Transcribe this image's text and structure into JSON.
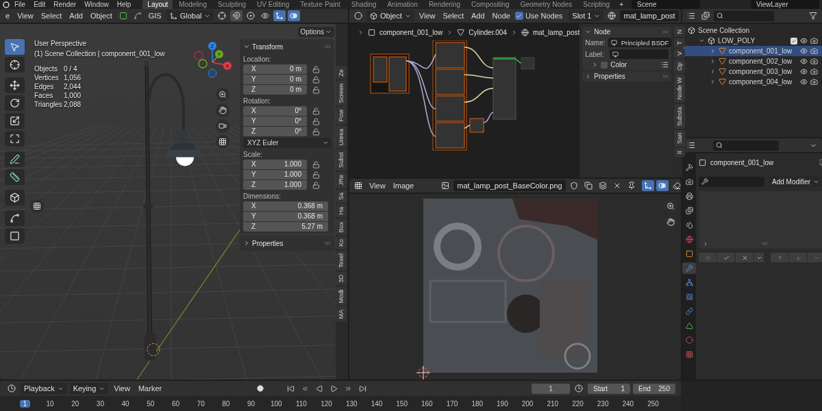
{
  "topbar": {
    "menus": [
      "File",
      "Edit",
      "Render",
      "Window",
      "Help"
    ],
    "workspaces": [
      {
        "label": "Layout",
        "selected": true
      },
      {
        "label": "Modeling",
        "selected": false
      },
      {
        "label": "Sculpting",
        "selected": false
      },
      {
        "label": "UV Editing",
        "selected": false
      },
      {
        "label": "Texture Paint",
        "selected": false
      },
      {
        "label": "Shading",
        "selected": false
      },
      {
        "label": "Animation",
        "selected": false
      },
      {
        "label": "Rendering",
        "selected": false
      },
      {
        "label": "Compositing",
        "selected": false
      },
      {
        "label": "Geometry Nodes",
        "selected": false
      },
      {
        "label": "Scripting",
        "selected": false
      }
    ],
    "add_tab": "+",
    "scene": "Scene",
    "view_layer": "ViewLayer"
  },
  "viewport": {
    "header": {
      "mode": "e",
      "menus": [
        "View",
        "Select",
        "Add",
        "Object"
      ],
      "gis": "GIS",
      "orientation": "Global",
      "toggles": [
        {
          "kind": "snap",
          "on": true
        },
        {
          "kind": "proportional",
          "on": false
        },
        {
          "kind": "gizmo",
          "on": true
        },
        {
          "kind": "overlay",
          "on": true
        }
      ]
    },
    "options": "Options",
    "tools": [
      {
        "kind": "select",
        "selected": true
      },
      {
        "kind": "cursor",
        "selected": false
      },
      {
        "kind": "move",
        "selected": false
      },
      {
        "kind": "rotate",
        "selected": false
      },
      {
        "kind": "scale",
        "selected": false
      },
      {
        "kind": "transform",
        "selected": false
      },
      {
        "kind": "annotate",
        "selected": false
      },
      {
        "kind": "measure",
        "selected": false
      },
      {
        "kind": "add_cube",
        "selected": false
      },
      {
        "kind": "corner",
        "selected": false
      },
      {
        "kind": "diagonal",
        "selected": false
      }
    ],
    "info": {
      "perspective": "User Perspective",
      "collection": "(1) Scene Collection | component_001_low",
      "stats": [
        {
          "label": "Objects",
          "value": "0 / 4"
        },
        {
          "label": "Vertices",
          "value": "1,056"
        },
        {
          "label": "Edges",
          "value": "2,044"
        },
        {
          "label": "Faces",
          "value": "1,000"
        },
        {
          "label": "Triangles",
          "value": "2,088"
        }
      ]
    },
    "axes": [
      {
        "label": "Z",
        "color": "#2f83e0"
      },
      {
        "label": "Y",
        "color": "#6ba621"
      },
      {
        "label": "X",
        "color": "#e43a4b"
      }
    ],
    "transform": {
      "title": "Transform",
      "groups": [
        {
          "label": "Location:",
          "kind": "lockable",
          "rows": [
            {
              "axis": "X",
              "value": "0 m"
            },
            {
              "axis": "Y",
              "value": "0 m"
            },
            {
              "axis": "Z",
              "value": "0 m"
            }
          ]
        },
        {
          "label": "Rotation:",
          "kind": "lockable",
          "mode": "XYZ Euler",
          "rows": [
            {
              "axis": "X",
              "value": "0°"
            },
            {
              "axis": "Y",
              "value": "0°"
            },
            {
              "axis": "Z",
              "value": "0°"
            }
          ]
        },
        {
          "label": "Scale:",
          "kind": "lockable",
          "rows": [
            {
              "axis": "X",
              "value": "1.000"
            },
            {
              "axis": "Y",
              "value": "1.000"
            },
            {
              "axis": "Z",
              "value": "1.000"
            }
          ]
        },
        {
          "label": "Dimensions:",
          "kind": "wide",
          "rows": [
            {
              "axis": "X",
              "value": "0.368 m"
            },
            {
              "axis": "Y",
              "value": "0.368 m"
            },
            {
              "axis": "Z",
              "value": "5.27 m"
            }
          ]
        }
      ],
      "properties": "Properties"
    },
    "tabs": [
      "Ze",
      "Screen",
      "Pow",
      "Unrea",
      "Subst",
      "JRe",
      "Sa",
      "Ha",
      "Box",
      "Ko",
      "Texel",
      "3D",
      "Modi",
      "MA"
    ]
  },
  "node_editor": {
    "mode": "Object",
    "menus": [
      "View",
      "Select",
      "Add",
      "Node"
    ],
    "use_nodes": {
      "label": "Use Nodes",
      "checked": true
    },
    "slot": "Slot 1",
    "material": "mat_lamp_post",
    "breadcrumbs": [
      "component_001_low",
      "Cylinder.004",
      "mat_lamp_post"
    ],
    "node_panel": {
      "title": "Node",
      "name_label": "Name:",
      "name": "Principled BSDF",
      "label_label": "Label:",
      "color_option": {
        "label": "Color",
        "checked": false
      },
      "properties": "Properties"
    },
    "tabs": [
      "N",
      "T",
      "V",
      "Op",
      "Node W",
      "Substa",
      "San",
      "It"
    ]
  },
  "image_editor": {
    "menus": [
      "View",
      "Image"
    ],
    "image": "mat_lamp_post_BaseColor.png",
    "toggles": [
      {
        "kind": "gizmo",
        "on": true
      },
      {
        "kind": "overlay",
        "on": true
      }
    ]
  },
  "outliner": {
    "items": [
      {
        "name": "Scene Collection",
        "selected": false,
        "children": [
          {
            "name": "LOW_POLY",
            "selected": false,
            "expanded": true,
            "checked": true,
            "children": [
              {
                "name": "component_001_low",
                "selected": true,
                "expanded": false
              },
              {
                "name": "component_002_low",
                "selected": false,
                "expanded": false
              },
              {
                "name": "component_003_low",
                "selected": false,
                "expanded": false
              },
              {
                "name": "component_004_low",
                "selected": false,
                "expanded": false
              }
            ]
          }
        ]
      }
    ]
  },
  "properties": {
    "object": "component_001_low",
    "add_modifier": "Add Modifier",
    "tabs": [
      {
        "kind": "tool",
        "selected": false
      },
      {
        "kind": "render",
        "selected": false
      },
      {
        "kind": "output",
        "selected": false
      },
      {
        "kind": "view_layer",
        "selected": false
      },
      {
        "kind": "scene",
        "selected": false
      },
      {
        "kind": "world",
        "selected": false
      },
      {
        "kind": "object",
        "selected": false
      },
      {
        "kind": "modifiers",
        "selected": true
      },
      {
        "kind": "particles",
        "selected": false
      },
      {
        "kind": "physics",
        "selected": false
      },
      {
        "kind": "constraints",
        "selected": false
      },
      {
        "kind": "data",
        "selected": false
      },
      {
        "kind": "material",
        "selected": false
      },
      {
        "kind": "texture",
        "selected": false
      }
    ]
  },
  "timeline": {
    "menus": [
      "Playback",
      "Keying",
      "View",
      "Marker"
    ],
    "frame": "1",
    "start_label": "Start",
    "start": "1",
    "end_label": "End",
    "end": "250",
    "ruler": [
      {
        "label": "1",
        "selected": true
      },
      {
        "label": "10",
        "selected": false
      },
      {
        "label": "20",
        "selected": false
      },
      {
        "label": "30",
        "selected": false
      },
      {
        "label": "40",
        "selected": false
      },
      {
        "label": "50",
        "selected": false
      },
      {
        "label": "60",
        "selected": false
      },
      {
        "label": "70",
        "selected": false
      },
      {
        "label": "80",
        "selected": false
      },
      {
        "label": "90",
        "selected": false
      },
      {
        "label": "100",
        "selected": false
      },
      {
        "label": "110",
        "selected": false
      },
      {
        "label": "120",
        "selected": false
      },
      {
        "label": "130",
        "selected": false
      },
      {
        "label": "140",
        "selected": false
      },
      {
        "label": "150",
        "selected": false
      },
      {
        "label": "160",
        "selected": false
      },
      {
        "label": "170",
        "selected": false
      },
      {
        "label": "180",
        "selected": false
      },
      {
        "label": "190",
        "selected": false
      },
      {
        "label": "200",
        "selected": false
      },
      {
        "label": "210",
        "selected": false
      },
      {
        "label": "220",
        "selected": false
      },
      {
        "label": "230",
        "selected": false
      },
      {
        "label": "240",
        "selected": false
      },
      {
        "label": "250",
        "selected": false
      }
    ]
  }
}
